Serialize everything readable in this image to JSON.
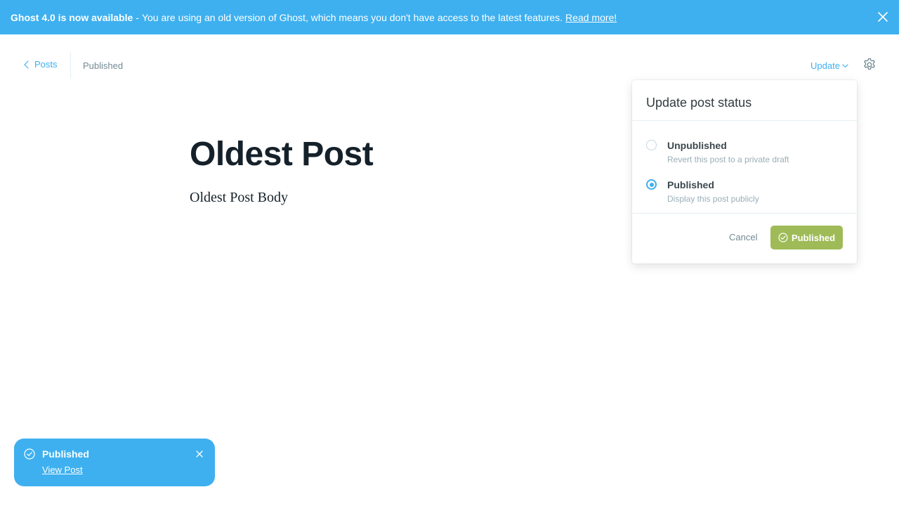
{
  "banner": {
    "title": "Ghost 4.0 is now available",
    "separator": "-",
    "message": "You are using an old version of Ghost, which means you don't have access to the latest features.",
    "link_text": "Read more!",
    "close_icon": "close-icon"
  },
  "header": {
    "back_label": "Posts",
    "status": "Published",
    "update_label": "Update",
    "settings_icon": "gear-icon"
  },
  "post": {
    "title": "Oldest Post",
    "body": "Oldest Post Body"
  },
  "dropdown": {
    "title": "Update post status",
    "options": [
      {
        "label": "Unpublished",
        "description": "Revert this post to a private draft",
        "selected": false
      },
      {
        "label": "Published",
        "description": "Display this post publicly",
        "selected": true
      }
    ],
    "cancel_label": "Cancel",
    "publish_label": "Published"
  },
  "toast": {
    "title": "Published",
    "link_text": "View Post"
  },
  "colors": {
    "accent": "#3eb0ef",
    "publish_green": "#9fbb58",
    "text_dark": "#15212a",
    "text_muted": "#738a94"
  }
}
